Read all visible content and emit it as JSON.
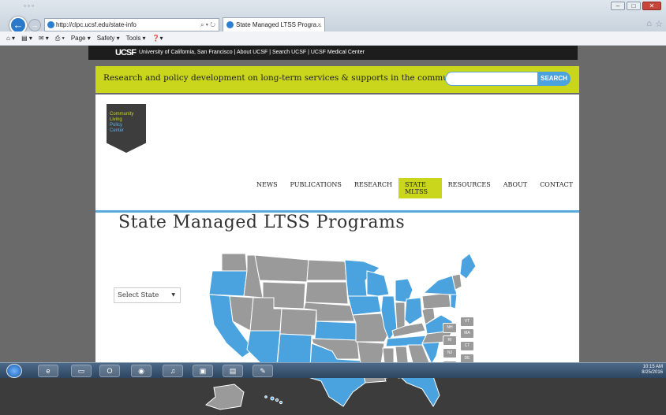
{
  "browser": {
    "address": "http://clpc.ucsf.edu/state-info",
    "address_controls": "⌕ ▾ ↻",
    "tab_title": "State Managed LTSS Progra...",
    "tab_close": "×",
    "commands": [
      "Page ▾",
      "Safety ▾",
      "Tools ▾"
    ]
  },
  "ucsf_bar": {
    "logo": "UCSF",
    "links": "University of California, San Francisco  |  About UCSF  |  Search UCSF  |  UCSF Medical Center"
  },
  "banner": {
    "tagline": "Research and policy development on long-term services & supports in the community",
    "search_button": "SEARCH"
  },
  "logo": {
    "line1": "Community",
    "line2": "Living",
    "line3": "Policy",
    "line4": "Center"
  },
  "nav": [
    "NEWS",
    "PUBLICATIONS",
    "RESEARCH",
    "STATE MLTSS",
    "RESOURCES",
    "ABOUT",
    "CONTACT"
  ],
  "page": {
    "title": "State Managed LTSS Programs",
    "select_value": "Select State"
  },
  "small_states": [
    "VT",
    "NH",
    "MA",
    "RI",
    "CT",
    "NJ",
    "DE",
    "MD",
    "DC"
  ],
  "colors": {
    "accent_green": "#c9d61c",
    "accent_blue": "#4aa3df",
    "state_gray": "#9a9a9a"
  },
  "tray": {
    "time": "10:15 AM",
    "date": "8/25/2016"
  }
}
